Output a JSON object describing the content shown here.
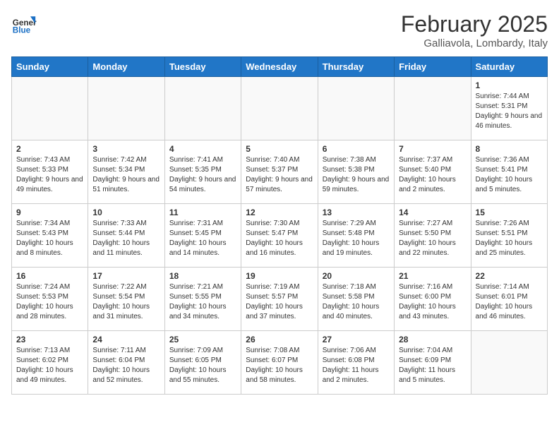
{
  "logo": {
    "general": "General",
    "blue": "Blue"
  },
  "title": "February 2025",
  "subtitle": "Galliavola, Lombardy, Italy",
  "weekdays": [
    "Sunday",
    "Monday",
    "Tuesday",
    "Wednesday",
    "Thursday",
    "Friday",
    "Saturday"
  ],
  "weeks": [
    [
      {
        "day": "",
        "info": ""
      },
      {
        "day": "",
        "info": ""
      },
      {
        "day": "",
        "info": ""
      },
      {
        "day": "",
        "info": ""
      },
      {
        "day": "",
        "info": ""
      },
      {
        "day": "",
        "info": ""
      },
      {
        "day": "1",
        "info": "Sunrise: 7:44 AM\nSunset: 5:31 PM\nDaylight: 9 hours and 46 minutes."
      }
    ],
    [
      {
        "day": "2",
        "info": "Sunrise: 7:43 AM\nSunset: 5:33 PM\nDaylight: 9 hours and 49 minutes."
      },
      {
        "day": "3",
        "info": "Sunrise: 7:42 AM\nSunset: 5:34 PM\nDaylight: 9 hours and 51 minutes."
      },
      {
        "day": "4",
        "info": "Sunrise: 7:41 AM\nSunset: 5:35 PM\nDaylight: 9 hours and 54 minutes."
      },
      {
        "day": "5",
        "info": "Sunrise: 7:40 AM\nSunset: 5:37 PM\nDaylight: 9 hours and 57 minutes."
      },
      {
        "day": "6",
        "info": "Sunrise: 7:38 AM\nSunset: 5:38 PM\nDaylight: 9 hours and 59 minutes."
      },
      {
        "day": "7",
        "info": "Sunrise: 7:37 AM\nSunset: 5:40 PM\nDaylight: 10 hours and 2 minutes."
      },
      {
        "day": "8",
        "info": "Sunrise: 7:36 AM\nSunset: 5:41 PM\nDaylight: 10 hours and 5 minutes."
      }
    ],
    [
      {
        "day": "9",
        "info": "Sunrise: 7:34 AM\nSunset: 5:43 PM\nDaylight: 10 hours and 8 minutes."
      },
      {
        "day": "10",
        "info": "Sunrise: 7:33 AM\nSunset: 5:44 PM\nDaylight: 10 hours and 11 minutes."
      },
      {
        "day": "11",
        "info": "Sunrise: 7:31 AM\nSunset: 5:45 PM\nDaylight: 10 hours and 14 minutes."
      },
      {
        "day": "12",
        "info": "Sunrise: 7:30 AM\nSunset: 5:47 PM\nDaylight: 10 hours and 16 minutes."
      },
      {
        "day": "13",
        "info": "Sunrise: 7:29 AM\nSunset: 5:48 PM\nDaylight: 10 hours and 19 minutes."
      },
      {
        "day": "14",
        "info": "Sunrise: 7:27 AM\nSunset: 5:50 PM\nDaylight: 10 hours and 22 minutes."
      },
      {
        "day": "15",
        "info": "Sunrise: 7:26 AM\nSunset: 5:51 PM\nDaylight: 10 hours and 25 minutes."
      }
    ],
    [
      {
        "day": "16",
        "info": "Sunrise: 7:24 AM\nSunset: 5:53 PM\nDaylight: 10 hours and 28 minutes."
      },
      {
        "day": "17",
        "info": "Sunrise: 7:22 AM\nSunset: 5:54 PM\nDaylight: 10 hours and 31 minutes."
      },
      {
        "day": "18",
        "info": "Sunrise: 7:21 AM\nSunset: 5:55 PM\nDaylight: 10 hours and 34 minutes."
      },
      {
        "day": "19",
        "info": "Sunrise: 7:19 AM\nSunset: 5:57 PM\nDaylight: 10 hours and 37 minutes."
      },
      {
        "day": "20",
        "info": "Sunrise: 7:18 AM\nSunset: 5:58 PM\nDaylight: 10 hours and 40 minutes."
      },
      {
        "day": "21",
        "info": "Sunrise: 7:16 AM\nSunset: 6:00 PM\nDaylight: 10 hours and 43 minutes."
      },
      {
        "day": "22",
        "info": "Sunrise: 7:14 AM\nSunset: 6:01 PM\nDaylight: 10 hours and 46 minutes."
      }
    ],
    [
      {
        "day": "23",
        "info": "Sunrise: 7:13 AM\nSunset: 6:02 PM\nDaylight: 10 hours and 49 minutes."
      },
      {
        "day": "24",
        "info": "Sunrise: 7:11 AM\nSunset: 6:04 PM\nDaylight: 10 hours and 52 minutes."
      },
      {
        "day": "25",
        "info": "Sunrise: 7:09 AM\nSunset: 6:05 PM\nDaylight: 10 hours and 55 minutes."
      },
      {
        "day": "26",
        "info": "Sunrise: 7:08 AM\nSunset: 6:07 PM\nDaylight: 10 hours and 58 minutes."
      },
      {
        "day": "27",
        "info": "Sunrise: 7:06 AM\nSunset: 6:08 PM\nDaylight: 11 hours and 2 minutes."
      },
      {
        "day": "28",
        "info": "Sunrise: 7:04 AM\nSunset: 6:09 PM\nDaylight: 11 hours and 5 minutes."
      },
      {
        "day": "",
        "info": ""
      }
    ]
  ]
}
